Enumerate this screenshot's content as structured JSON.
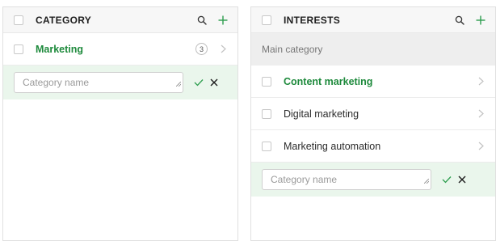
{
  "left_panel": {
    "title": "CATEGORY",
    "rows": [
      {
        "label": "Marketing",
        "count": "3",
        "active": true
      }
    ],
    "edit": {
      "placeholder": "Category name"
    }
  },
  "right_panel": {
    "title": "INTERESTS",
    "section_label": "Main category",
    "rows": [
      {
        "label": "Content marketing",
        "active": true
      },
      {
        "label": "Digital marketing",
        "active": false
      },
      {
        "label": "Marketing automation",
        "active": false
      }
    ],
    "edit": {
      "placeholder": "Category name"
    }
  },
  "colors": {
    "accent_green": "#1e8a3c",
    "edit_row_bg": "#eaf6ec",
    "header_bg": "#f7f7f7"
  },
  "icons": {
    "search": "search-icon",
    "add": "plus-icon",
    "chevron": "chevron-right-icon",
    "confirm": "check-icon",
    "cancel": "close-icon"
  }
}
